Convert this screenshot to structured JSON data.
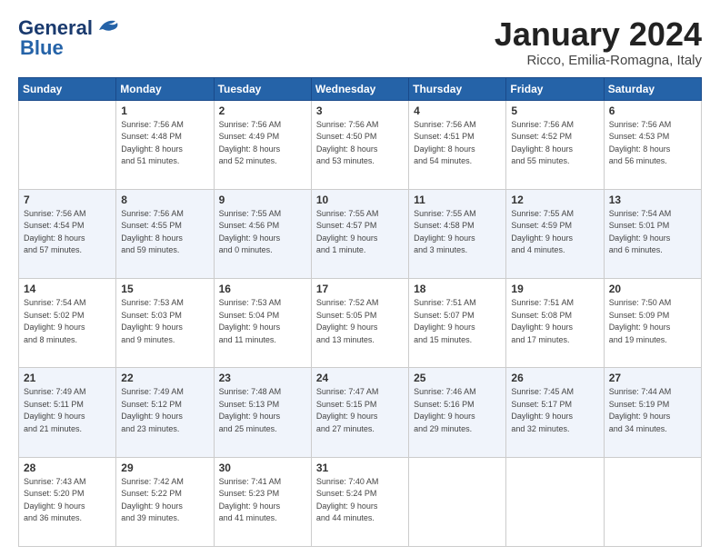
{
  "logo": {
    "line1": "General",
    "line2": "Blue"
  },
  "title": "January 2024",
  "location": "Ricco, Emilia-Romagna, Italy",
  "weekdays": [
    "Sunday",
    "Monday",
    "Tuesday",
    "Wednesday",
    "Thursday",
    "Friday",
    "Saturday"
  ],
  "weeks": [
    [
      {
        "day": "",
        "info": ""
      },
      {
        "day": "1",
        "info": "Sunrise: 7:56 AM\nSunset: 4:48 PM\nDaylight: 8 hours\nand 51 minutes."
      },
      {
        "day": "2",
        "info": "Sunrise: 7:56 AM\nSunset: 4:49 PM\nDaylight: 8 hours\nand 52 minutes."
      },
      {
        "day": "3",
        "info": "Sunrise: 7:56 AM\nSunset: 4:50 PM\nDaylight: 8 hours\nand 53 minutes."
      },
      {
        "day": "4",
        "info": "Sunrise: 7:56 AM\nSunset: 4:51 PM\nDaylight: 8 hours\nand 54 minutes."
      },
      {
        "day": "5",
        "info": "Sunrise: 7:56 AM\nSunset: 4:52 PM\nDaylight: 8 hours\nand 55 minutes."
      },
      {
        "day": "6",
        "info": "Sunrise: 7:56 AM\nSunset: 4:53 PM\nDaylight: 8 hours\nand 56 minutes."
      }
    ],
    [
      {
        "day": "7",
        "info": "Sunrise: 7:56 AM\nSunset: 4:54 PM\nDaylight: 8 hours\nand 57 minutes."
      },
      {
        "day": "8",
        "info": "Sunrise: 7:56 AM\nSunset: 4:55 PM\nDaylight: 8 hours\nand 59 minutes."
      },
      {
        "day": "9",
        "info": "Sunrise: 7:55 AM\nSunset: 4:56 PM\nDaylight: 9 hours\nand 0 minutes."
      },
      {
        "day": "10",
        "info": "Sunrise: 7:55 AM\nSunset: 4:57 PM\nDaylight: 9 hours\nand 1 minute."
      },
      {
        "day": "11",
        "info": "Sunrise: 7:55 AM\nSunset: 4:58 PM\nDaylight: 9 hours\nand 3 minutes."
      },
      {
        "day": "12",
        "info": "Sunrise: 7:55 AM\nSunset: 4:59 PM\nDaylight: 9 hours\nand 4 minutes."
      },
      {
        "day": "13",
        "info": "Sunrise: 7:54 AM\nSunset: 5:01 PM\nDaylight: 9 hours\nand 6 minutes."
      }
    ],
    [
      {
        "day": "14",
        "info": "Sunrise: 7:54 AM\nSunset: 5:02 PM\nDaylight: 9 hours\nand 8 minutes."
      },
      {
        "day": "15",
        "info": "Sunrise: 7:53 AM\nSunset: 5:03 PM\nDaylight: 9 hours\nand 9 minutes."
      },
      {
        "day": "16",
        "info": "Sunrise: 7:53 AM\nSunset: 5:04 PM\nDaylight: 9 hours\nand 11 minutes."
      },
      {
        "day": "17",
        "info": "Sunrise: 7:52 AM\nSunset: 5:05 PM\nDaylight: 9 hours\nand 13 minutes."
      },
      {
        "day": "18",
        "info": "Sunrise: 7:51 AM\nSunset: 5:07 PM\nDaylight: 9 hours\nand 15 minutes."
      },
      {
        "day": "19",
        "info": "Sunrise: 7:51 AM\nSunset: 5:08 PM\nDaylight: 9 hours\nand 17 minutes."
      },
      {
        "day": "20",
        "info": "Sunrise: 7:50 AM\nSunset: 5:09 PM\nDaylight: 9 hours\nand 19 minutes."
      }
    ],
    [
      {
        "day": "21",
        "info": "Sunrise: 7:49 AM\nSunset: 5:11 PM\nDaylight: 9 hours\nand 21 minutes."
      },
      {
        "day": "22",
        "info": "Sunrise: 7:49 AM\nSunset: 5:12 PM\nDaylight: 9 hours\nand 23 minutes."
      },
      {
        "day": "23",
        "info": "Sunrise: 7:48 AM\nSunset: 5:13 PM\nDaylight: 9 hours\nand 25 minutes."
      },
      {
        "day": "24",
        "info": "Sunrise: 7:47 AM\nSunset: 5:15 PM\nDaylight: 9 hours\nand 27 minutes."
      },
      {
        "day": "25",
        "info": "Sunrise: 7:46 AM\nSunset: 5:16 PM\nDaylight: 9 hours\nand 29 minutes."
      },
      {
        "day": "26",
        "info": "Sunrise: 7:45 AM\nSunset: 5:17 PM\nDaylight: 9 hours\nand 32 minutes."
      },
      {
        "day": "27",
        "info": "Sunrise: 7:44 AM\nSunset: 5:19 PM\nDaylight: 9 hours\nand 34 minutes."
      }
    ],
    [
      {
        "day": "28",
        "info": "Sunrise: 7:43 AM\nSunset: 5:20 PM\nDaylight: 9 hours\nand 36 minutes."
      },
      {
        "day": "29",
        "info": "Sunrise: 7:42 AM\nSunset: 5:22 PM\nDaylight: 9 hours\nand 39 minutes."
      },
      {
        "day": "30",
        "info": "Sunrise: 7:41 AM\nSunset: 5:23 PM\nDaylight: 9 hours\nand 41 minutes."
      },
      {
        "day": "31",
        "info": "Sunrise: 7:40 AM\nSunset: 5:24 PM\nDaylight: 9 hours\nand 44 minutes."
      },
      {
        "day": "",
        "info": ""
      },
      {
        "day": "",
        "info": ""
      },
      {
        "day": "",
        "info": ""
      }
    ]
  ]
}
